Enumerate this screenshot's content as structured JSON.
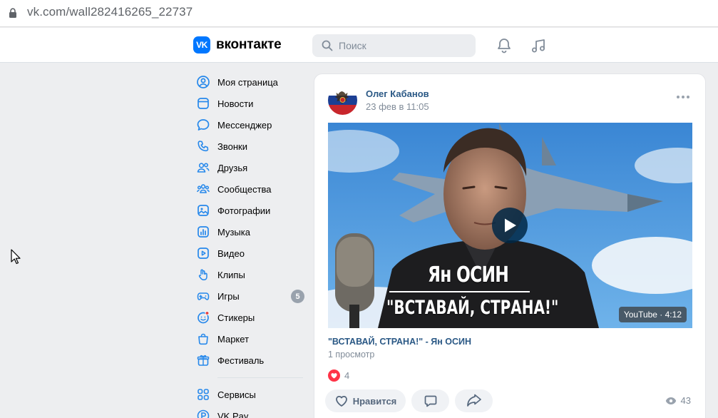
{
  "browser": {
    "url": "vk.com/wall282416265_22737",
    "url_domain": "vk.com",
    "url_path": "/wall282416265_22737"
  },
  "header": {
    "logo_text": "вконтакте",
    "search_placeholder": "Поиск"
  },
  "sidebar": {
    "items": [
      {
        "label": "Моя страница",
        "icon": "user-circle-icon"
      },
      {
        "label": "Новости",
        "icon": "newsfeed-icon"
      },
      {
        "label": "Мессенджер",
        "icon": "message-icon"
      },
      {
        "label": "Звонки",
        "icon": "phone-icon"
      },
      {
        "label": "Друзья",
        "icon": "friends-icon"
      },
      {
        "label": "Сообщества",
        "icon": "communities-icon"
      },
      {
        "label": "Фотографии",
        "icon": "photo-icon"
      },
      {
        "label": "Музыка",
        "icon": "music-icon"
      },
      {
        "label": "Видео",
        "icon": "video-icon"
      },
      {
        "label": "Клипы",
        "icon": "clips-icon"
      },
      {
        "label": "Игры",
        "icon": "gamepad-icon",
        "badge": "5"
      },
      {
        "label": "Стикеры",
        "icon": "sticker-icon"
      },
      {
        "label": "Маркет",
        "icon": "market-icon"
      },
      {
        "label": "Фестиваль",
        "icon": "gift-icon"
      }
    ],
    "items2": [
      {
        "label": "Сервисы",
        "icon": "services-icon"
      },
      {
        "label": "VK Pay",
        "icon": "vkpay-icon"
      }
    ]
  },
  "post": {
    "author": "Олег Кабанов",
    "date": "23 фев в 11:05",
    "video": {
      "overlay_line1": "Ян ОСИН",
      "overlay_line2": "\"ВСТАВАЙ, СТРАНА!\"",
      "source_label": "YouTube · 4:12",
      "title": "\"ВСТАВАЙ, СТРАНА!\" - Ян ОСИН",
      "views": "1 просмотр"
    },
    "reactions_count": "4",
    "like_label": "Нравится",
    "views_total": "43"
  },
  "colors": {
    "accent": "#0077ff",
    "link": "#2a5885",
    "muted": "#818c99",
    "page_bg": "#edeef0"
  }
}
